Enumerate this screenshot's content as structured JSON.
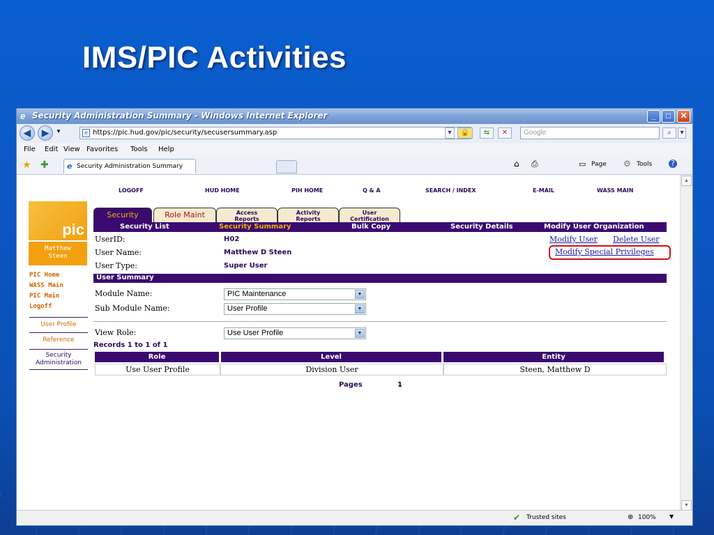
{
  "slide": {
    "title": "IMS/PIC Activities"
  },
  "browser": {
    "window_title": "Security Administration Summary - Windows Internet Explorer",
    "address": "https://pic.hud.gov/pic/security/secusersummary.asp",
    "search_placeholder": "Google",
    "menu": [
      "File",
      "Edit",
      "View",
      "Favorites",
      "Tools",
      "Help"
    ],
    "tab_title": "Security Administration Summary",
    "toolbar": {
      "page": "Page",
      "tools": "Tools"
    },
    "status": {
      "zone": "Trusted sites",
      "zoom": "100%"
    }
  },
  "page": {
    "top_nav": [
      "LOGOFF",
      "HUD HOME",
      "PIH HOME",
      "Q & A",
      "SEARCH / INDEX",
      "E-MAIL",
      "WASS MAIN"
    ],
    "logo_text": "pic",
    "user_box": [
      "Matthew",
      "Steen"
    ],
    "left_links": [
      "PIC Home",
      "WASS Main",
      "PIC Main",
      "Logoff"
    ],
    "left_boxes": [
      "User Profile",
      "Reference",
      "Security Administration"
    ],
    "tabs": {
      "security": "Security",
      "role_maint": "Role Maint",
      "access_reports": [
        "Access",
        "Reports"
      ],
      "activity_reports": [
        "Activity",
        "Reports"
      ],
      "user_certification": [
        "User",
        "Certification"
      ]
    },
    "subnav": [
      "Security List",
      "Security Summary",
      "Bulk Copy",
      "Security Details",
      "Modify User Organization"
    ],
    "fields": {
      "userid_label": "UserID:",
      "userid": "H02",
      "username_label": "User Name:",
      "username": "Matthew D Steen",
      "usertype_label": "User Type:",
      "usertype": "Super User"
    },
    "links": {
      "modify_user": "Modify User",
      "delete_user": "Delete User",
      "modify_special": "Modify Special Privileges"
    },
    "user_summary": "User Summary",
    "module_label": "Module Name:",
    "module_value": "PIC Maintenance",
    "submodule_label": "Sub Module Name:",
    "submodule_value": "User Profile",
    "viewrole_label": "View Role:",
    "viewrole_value": "Use User Profile",
    "records": "Records 1 to 1  of 1",
    "table": {
      "headers": [
        "Role",
        "Level",
        "Entity"
      ],
      "row": [
        "Use User Profile",
        "Division User",
        "Steen, Matthew D"
      ]
    },
    "pages_label": "Pages",
    "pages_value": "1"
  },
  "colors": {
    "highlight": "#d01010",
    "purple": "#3a0a70",
    "orange": "#f2a010"
  }
}
